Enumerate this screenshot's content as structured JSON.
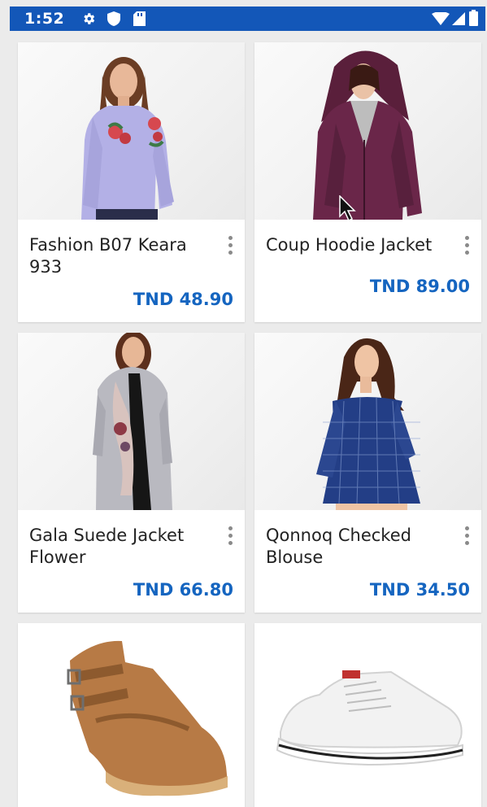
{
  "status_bar": {
    "time": "1:52",
    "icons": [
      "settings-icon",
      "shield-icon",
      "sd-card-icon",
      "wifi-icon",
      "signal-icon",
      "battery-icon"
    ],
    "color": "#1357b8"
  },
  "products": [
    {
      "title": "Fashion B07 Keara 933",
      "price": "TND 48.90",
      "image": "woman-striped-embroidered-shirt"
    },
    {
      "title": "Coup Hoodie Jacket",
      "price": "TND 89.00",
      "image": "woman-maroon-hoodie"
    },
    {
      "title": "Gala Suede Jacket Flower",
      "price": "TND 66.80",
      "image": "woman-grey-floral-long-coat"
    },
    {
      "title": "Qonnoq Checked Blouse",
      "price": "TND 34.50",
      "image": "woman-navy-checked-blouse"
    },
    {
      "title": "",
      "price": "",
      "image": "brown-buckle-ankle-boot"
    },
    {
      "title": "",
      "price": "",
      "image": "white-canvas-sneaker"
    }
  ],
  "colors": {
    "price": "#1565c0",
    "background": "#ebebeb",
    "card": "#ffffff"
  }
}
